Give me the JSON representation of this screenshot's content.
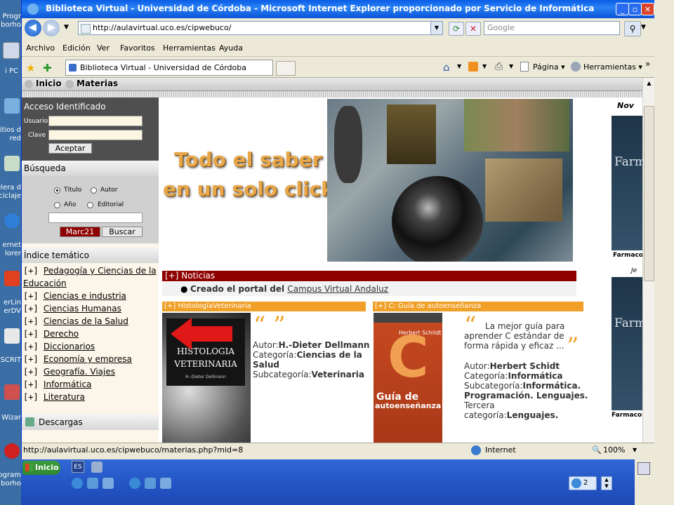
{
  "window": {
    "title": "Biblioteca Virtual - Universidad de Córdoba - Microsoft Internet Explorer proporcionado por Servicio de Informática",
    "controls": {
      "minimize": "_",
      "maximize": "▫",
      "close": "✕"
    }
  },
  "address_bar": {
    "url": "http://aulavirtual.uco.es/cipwebuco/",
    "search_placeholder": "Google"
  },
  "menu": [
    "Archivo",
    "Edición",
    "Ver",
    "Favoritos",
    "Herramientas",
    "Ayuda"
  ],
  "tab": {
    "title": "Biblioteca Virtual - Universidad de Córdoba"
  },
  "command_bar": {
    "page": "Página",
    "tools": "Herramientas",
    "more": "»"
  },
  "desktop_icons": [
    {
      "label": "Progr",
      "label2": "borho"
    },
    {
      "label": "i PC",
      "label2": ""
    },
    {
      "label": "sitios d",
      "label2": "red"
    },
    {
      "label": "elera d",
      "label2": "iciclaje"
    },
    {
      "label": "ernet",
      "label2": "lorer"
    },
    {
      "label": "erLin",
      "label2": "erDV"
    },
    {
      "label": "SCRIT",
      "label2": ""
    },
    {
      "label": "Wizar",
      "label2": ""
    },
    {
      "label": "ogram",
      "label2": "borho"
    }
  ],
  "site": {
    "nav": [
      "Inicio",
      "Materias"
    ],
    "login": {
      "title": "Acceso Identificado",
      "user_label": "Usuario",
      "pass_label": "Clave",
      "submit": "Aceptar"
    },
    "search": {
      "title": "Búsqueda",
      "options": [
        "Título",
        "Autor",
        "Año",
        "Editorial"
      ],
      "selected": "Título",
      "marc_button": "Marc21",
      "search_button": "Buscar"
    },
    "index": {
      "title": "Índice temático",
      "prefix": "[+]",
      "items": [
        {
          "line1": "Pedagogía y Ciencias de la",
          "line2": "Educación"
        },
        {
          "line1": "Ciencias e industria"
        },
        {
          "line1": "Ciencias Humanas"
        },
        {
          "line1": "Ciencias de la Salud"
        },
        {
          "line1": "Derecho"
        },
        {
          "line1": "Diccionarios"
        },
        {
          "line1": "Economía y empresa"
        },
        {
          "line1": "Geografía. Viajes"
        },
        {
          "line1": "Informática"
        },
        {
          "line1": "Literatura"
        }
      ]
    },
    "downloads": {
      "title": "Descargas"
    },
    "banner": {
      "line1": "Todo el saber",
      "line2": "en un solo click"
    },
    "news": {
      "title": "[+] Noticias",
      "items": [
        {
          "text": "Creado el portal del ",
          "link": "Campus Virtual Andaluz"
        }
      ]
    },
    "cards": [
      {
        "header": "[+] HistologíaVeterinaria",
        "cover_title_1": "HISTOLOGIA",
        "cover_title_2": "VETERINARIA",
        "cover_author": "H.-Dieter Dellmann",
        "author_label": "Autor:",
        "author": "H.-Dieter Dellmann",
        "category_label": "Categoría:",
        "category": "Ciencias de la Salud",
        "subcategory_label": "Subcategoría:",
        "subcategory": "Veterinaria"
      },
      {
        "header": "[+] C: Guía de autoenseñanza",
        "cover_author": "Herbert Schildt",
        "cover_letter": "C",
        "cover_title_1": "Guía de",
        "cover_title_2": "autoenseñanza",
        "quote": "La mejor guía para aprender C estándar de forma rápida y eficaz ...",
        "author_label": "Autor:",
        "author": "Herbert Schidt",
        "category_label": "Categoría:",
        "category": "Informática",
        "subcategory_label": "Subcategoría:",
        "subcategory": "Informática. Programación. Lenguajes.",
        "third_label": "Tercera categoría:",
        "third": "Lenguajes."
      }
    ],
    "right_column": {
      "heading": "Nov",
      "book_title": "Farm",
      "caption": "Farmacologí",
      "caption2": "Je"
    }
  },
  "status_bar": {
    "url": "http://aulavirtual.uco.es/cipwebuco/materias.php?mid=8",
    "zone": "Internet",
    "zoom": "100%"
  },
  "taskbar": {
    "start": "Inicio",
    "lang": "ES",
    "tray_count": "2"
  },
  "colors": {
    "news_red": "#8e0000",
    "card_orange": "#f0a028",
    "login_dark": "#4f4f4f",
    "marc_red": "#8e0000"
  }
}
